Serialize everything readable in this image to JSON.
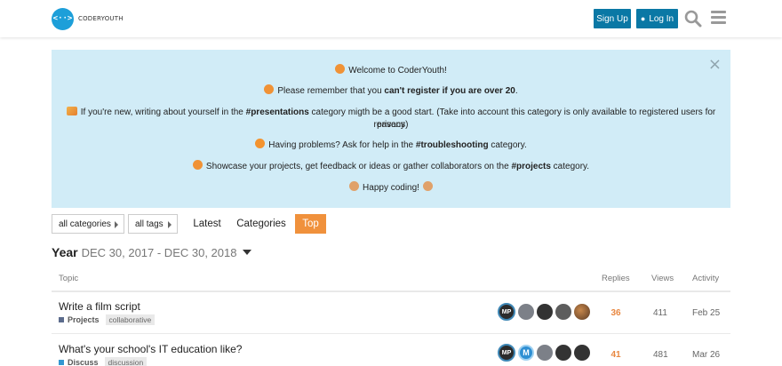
{
  "header": {
    "logo_glyph": "<··>",
    "logo_text": "CODERYOUTH",
    "signup_label": "Sign Up",
    "login_label": "Log In",
    "search_icon": "search-icon",
    "menu_icon": "hamburger-menu-icon",
    "accent": "#0a78a5"
  },
  "banner": {
    "close_glyph": "×",
    "welcome": "Welcome to CoderYouth!",
    "rule_pre": "Please remember that you ",
    "rule_bold": "can't register if you are over 20",
    "rule_post": ".",
    "new_pre": "If you're new, writing about yourself in the ",
    "new_bold": "#presentations",
    "new_post": " category migth be a good start. (Take into account this category is only available to registered users for privacy",
    "new_line2": "reasons)",
    "help_pre": "Having problems? Ask for help in the ",
    "help_bold": "#troubleshooting",
    "help_post": " category.",
    "showcase_pre": "Showcase your projects, get feedback or ideas or gather collaborators on the ",
    "showcase_bold": "#projects",
    "showcase_post": " category.",
    "happy": "Happy coding!",
    "background": "#d1ecf7"
  },
  "nav": {
    "categories_dropdown": "all categories",
    "tags_dropdown": "all tags",
    "latest": "Latest",
    "categories": "Categories",
    "top": "Top",
    "active_color": "#f0913c"
  },
  "period": {
    "label": "Year",
    "range": "DEC 30, 2017 - DEC 30, 2018"
  },
  "table": {
    "headers": {
      "topic": "Topic",
      "replies": "Replies",
      "views": "Views",
      "activity": "Activity"
    },
    "rows": [
      {
        "title": "Write a film script",
        "category": "Projects",
        "category_color": "#5b6b8c",
        "tag": "collaborative",
        "first_avatar": "MP",
        "replies": "36",
        "views": "411",
        "activity": "Feb 25"
      },
      {
        "title": "What's your school's IT education like?",
        "category": "Discuss",
        "category_color": "#3397d1",
        "tag": "discussion",
        "first_avatar": "MP",
        "second_avatar": "M",
        "replies": "41",
        "views": "481",
        "activity": "Mar 26"
      }
    ]
  }
}
